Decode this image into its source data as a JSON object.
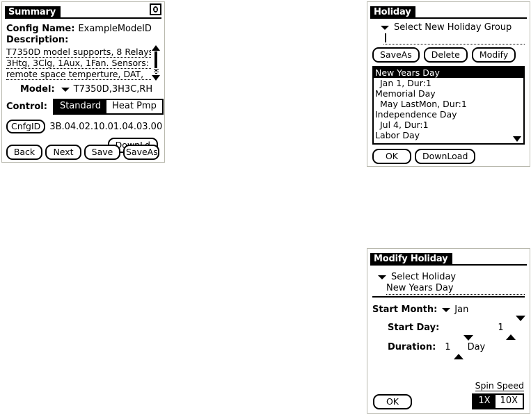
{
  "summary": {
    "title": "Summary",
    "info_icon": "info-icon",
    "config_name_label": "Config Name:",
    "config_name_value": "ExampleModelD",
    "description_label": "Description:",
    "description_lines": [
      "T7350D model supports, 8 Relays:",
      "3Htg, 3Clg, 1Aux, 1Fan.  Sensors:",
      "remote space temperture, DAT,"
    ],
    "model_label": "Model:",
    "model_value": "T7350D,3H3C,RH",
    "control_label": "Control:",
    "control_options": [
      "Standard",
      "Heat Pmp"
    ],
    "control_selected": "Standard",
    "cnfgid_button": "CnfgID",
    "cnfgid_value": "3B.04.02.10.01.04.03.00",
    "downld_button": "DownLd",
    "buttons": [
      "Back",
      "Next",
      "Save",
      "SaveAs"
    ]
  },
  "holiday": {
    "title": "Holiday",
    "select_label": "Select New Holiday Group",
    "input_value": "",
    "buttons": [
      "SaveAs",
      "Delete",
      "Modify"
    ],
    "list": [
      {
        "text": "New Years Day",
        "selected": true,
        "sub": false
      },
      {
        "text": "Jan 1, Dur:1",
        "selected": false,
        "sub": true
      },
      {
        "text": "Memorial Day",
        "selected": false,
        "sub": false
      },
      {
        "text": "May LastMon, Dur:1",
        "selected": false,
        "sub": true
      },
      {
        "text": "Independence Day",
        "selected": false,
        "sub": false
      },
      {
        "text": "Jul 4, Dur:1",
        "selected": false,
        "sub": true
      },
      {
        "text": "Labor Day",
        "selected": false,
        "sub": false
      }
    ],
    "footer_buttons": [
      "OK",
      "DownLoad"
    ]
  },
  "modify": {
    "title": "Modify Holiday",
    "select_label": "Select Holiday",
    "select_value": "New Years Day",
    "start_month_label": "Start Month:",
    "start_month_value": "Jan",
    "start_day_label": "Start Day:",
    "start_day_value": "1",
    "duration_label": "Duration:",
    "duration_value": "1",
    "duration_unit": "Day",
    "spin_speed_label": "Spin Speed",
    "spin_speed_options": [
      "1X",
      "10X"
    ],
    "spin_speed_selected": "1X",
    "ok_button": "OK"
  },
  "colors": {
    "ink": "#000000",
    "paper": "#ffffff",
    "panel_border": "#b9b9ae"
  }
}
